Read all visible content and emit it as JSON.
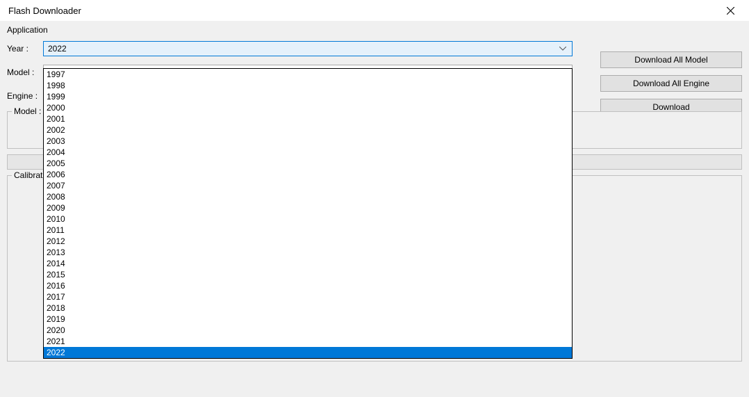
{
  "window": {
    "title": "Flash Downloader"
  },
  "labels": {
    "application": "Application",
    "year": "Year :",
    "model": "Model :",
    "engine": "Engine :",
    "model_group": "Model : L",
    "calibration_group": "Calibration"
  },
  "buttons": {
    "download_all_model": "Download All Model",
    "download_all_engine": "Download All Engine",
    "download": "Download"
  },
  "year_combo": {
    "value": "2022",
    "options": [
      "1997",
      "1998",
      "1999",
      "2000",
      "2001",
      "2002",
      "2003",
      "2004",
      "2005",
      "2006",
      "2007",
      "2008",
      "2009",
      "2010",
      "2011",
      "2012",
      "2013",
      "2014",
      "2015",
      "2016",
      "2017",
      "2018",
      "2019",
      "2020",
      "2021",
      "2022"
    ],
    "selected": "2022"
  },
  "model_combo": {
    "value": ""
  },
  "engine_combo": {
    "value": ""
  }
}
